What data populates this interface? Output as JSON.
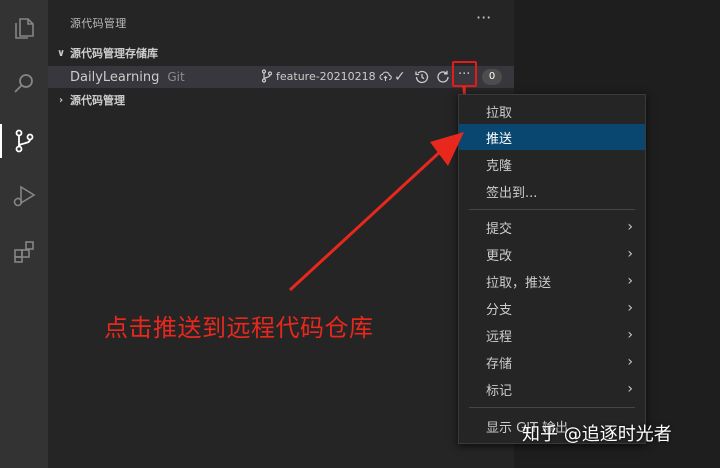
{
  "sidebar": {
    "title": "源代码管理",
    "more_icon": "ellipsis-icon",
    "sections": [
      {
        "label": "源代码管理存储库",
        "expanded": true
      },
      {
        "label": "源代码管理",
        "expanded": false
      }
    ]
  },
  "repo": {
    "name": "DailyLearning",
    "kind": "Git",
    "branch": "feature-20210218",
    "badge_count": "0"
  },
  "activity_bar": {
    "icons": [
      "explorer-icon",
      "search-icon",
      "source-control-icon",
      "run-debug-icon",
      "extensions-icon"
    ]
  },
  "menu": {
    "items": [
      {
        "label": "拉取",
        "submenu": false
      },
      {
        "label": "推送",
        "submenu": false,
        "active": true
      },
      {
        "label": "克隆",
        "submenu": false
      },
      {
        "label": "签出到...",
        "submenu": false
      },
      {
        "label": "提交",
        "submenu": true
      },
      {
        "label": "更改",
        "submenu": true
      },
      {
        "label": "拉取，推送",
        "submenu": true
      },
      {
        "label": "分支",
        "submenu": true
      },
      {
        "label": "远程",
        "submenu": true
      },
      {
        "label": "存储",
        "submenu": true
      },
      {
        "label": "标记",
        "submenu": true
      },
      {
        "label": "显示 GIT 输出",
        "submenu": false
      }
    ]
  },
  "annotation": {
    "text": "点击推送到远程代码仓库",
    "color": "#e8281d"
  },
  "watermark": {
    "text": "知乎 @追逐时光者"
  },
  "colors": {
    "activity_bar": "#333333",
    "sidebar": "#252526",
    "selection": "#094771",
    "highlight": "#e51b1b"
  }
}
